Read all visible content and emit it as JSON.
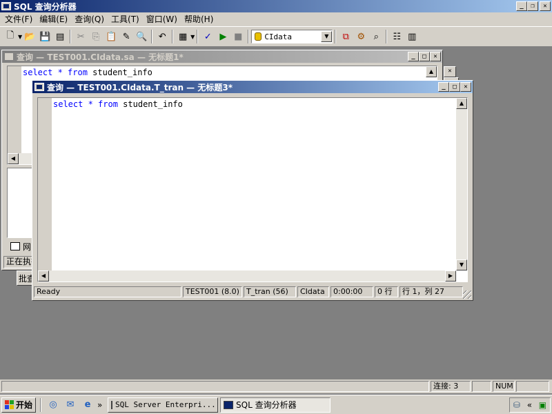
{
  "app": {
    "title": "SQL 查询分析器",
    "menu": [
      "文件(F)",
      "编辑(E)",
      "查询(Q)",
      "工具(T)",
      "窗口(W)",
      "帮助(H)"
    ],
    "database_selector": "CIdata"
  },
  "back_window": {
    "title": "查询 — TEST001.CIdata.sa — 无标题1*",
    "sql_tokens": [
      "select",
      " * ",
      "from",
      " student_info"
    ],
    "result_tab": "网",
    "status_text": "正在执行",
    "batch_text": "批查"
  },
  "front_window": {
    "title": "查询 — TEST001.CIdata.T_tran — 无标题3*",
    "sql_tokens": [
      "select",
      " * ",
      "from",
      " student_info"
    ],
    "status": {
      "ready": "Ready",
      "server": "TEST001 (8.0)",
      "user": "T_tran (56)",
      "db": "CIdata",
      "time": "0:00:00",
      "rows": "0 行",
      "pos": "行 1，列 27"
    }
  },
  "app_status": {
    "connections": "连接: 3",
    "num": "NUM"
  },
  "taskbar": {
    "start": "开始",
    "tasks": [
      "SQL Server Enterpri...",
      "SQL 查询分析器"
    ],
    "chevron": "»",
    "tray_chevron": "«"
  },
  "colors": {
    "title_active": "#0a246a",
    "keyword": "#0000ff",
    "desktop": "#808080"
  }
}
